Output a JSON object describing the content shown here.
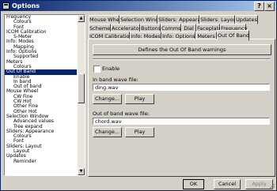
{
  "window": {
    "title": "Options"
  },
  "tree": {
    "items": [
      {
        "label": "Frequency",
        "level": 0
      },
      {
        "label": "Colours",
        "level": 1
      },
      {
        "label": "Font",
        "level": 1
      },
      {
        "label": "ICOM Calibration",
        "level": 0
      },
      {
        "label": "S-Meter",
        "level": 1
      },
      {
        "label": "Info: Modes",
        "level": 0
      },
      {
        "label": "Mapping",
        "level": 1
      },
      {
        "label": "Info: Options",
        "level": 0
      },
      {
        "label": "Supported",
        "level": 1
      },
      {
        "label": "Meters",
        "level": 0
      },
      {
        "label": "Colours",
        "level": 1
      },
      {
        "label": "Out Of Band",
        "level": 0,
        "selected": true
      },
      {
        "label": "Enable",
        "level": 1
      },
      {
        "label": "In band",
        "level": 1
      },
      {
        "label": "Out of band",
        "level": 1
      },
      {
        "label": "Mouse Wheel",
        "level": 0
      },
      {
        "label": "CW Fine",
        "level": 1
      },
      {
        "label": "CW Hot",
        "level": 1
      },
      {
        "label": "Other Fine",
        "level": 1
      },
      {
        "label": "Other Hot",
        "level": 1
      },
      {
        "label": "Selection Window",
        "level": 0
      },
      {
        "label": "Advanced values",
        "level": 1
      },
      {
        "label": "Tree expand",
        "level": 1
      },
      {
        "label": "Sliders: Appearance",
        "level": 0
      },
      {
        "label": "Colours",
        "level": 1
      },
      {
        "label": "Font",
        "level": 1
      },
      {
        "label": "Sliders: Layout",
        "level": 0
      },
      {
        "label": "Layout",
        "level": 1
      },
      {
        "label": "Updates",
        "level": 0
      },
      {
        "label": "Reminder",
        "level": 1
      }
    ]
  },
  "tabs": {
    "row1": [
      "Mouse Wheel",
      "Selection Window",
      "Sliders: Appearance",
      "Sliders: Layout",
      "Updates"
    ],
    "row2": [
      "Schemes",
      "Accelerators",
      "Buttons",
      "Comms",
      "Dial",
      "Faceplate",
      "Frequency"
    ],
    "row3": [
      "ICOM Calibration",
      "Info: Modes",
      "Info: Options",
      "Meters",
      "Out Of Band"
    ]
  },
  "panel": {
    "define_button": "Defines the Out Of Band warnings",
    "enable_label": "Enable",
    "enable_checked": false,
    "in_band_label": "In band wave file:",
    "in_band_value": "ding.wav",
    "change_label": "Change...",
    "play_label": "Play",
    "out_band_label": "Out of band wave file:",
    "out_band_value": "chord.wav"
  },
  "footer": {
    "ok": "OK",
    "cancel": "Cancel",
    "apply": "Apply"
  }
}
